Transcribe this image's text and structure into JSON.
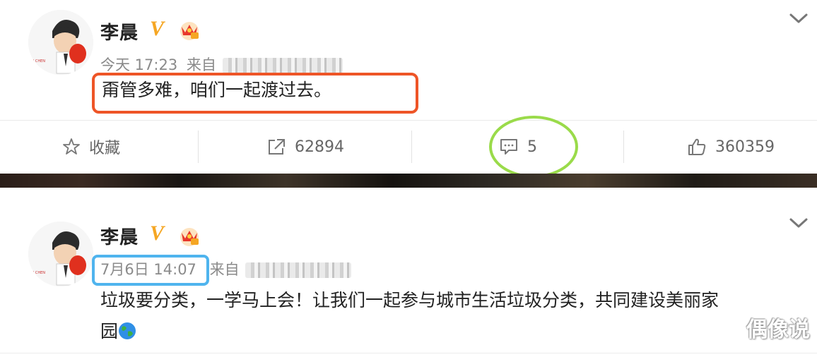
{
  "posts": [
    {
      "author": "李晨",
      "verified_badge": "V",
      "time": "今天 17:23",
      "source_prefix": "来自",
      "text": "甭管多难，咱们一起渡过去。",
      "actions": {
        "favorite_label": "收藏",
        "repost_count": "62894",
        "comment_count": "5",
        "like_count": "360359"
      }
    },
    {
      "author": "李晨",
      "verified_badge": "V",
      "time": "7月6日 14:07",
      "source_prefix": "来自",
      "text_line1": "垃圾要分类，一学马上会！让我们一起参与城市生活垃圾分类，共同建设美丽家",
      "text_line2": "园"
    }
  ],
  "watermark": "偶像说",
  "icons": [
    "star-icon",
    "repost-icon",
    "comment-icon",
    "like-icon",
    "chevron-down-icon",
    "crown-icon",
    "globe-icon"
  ],
  "colors": {
    "highlight_red": "#ee5527",
    "highlight_green": "#9adb4a",
    "highlight_blue": "#4fb4ee",
    "verified_gold": "#f5a623"
  }
}
